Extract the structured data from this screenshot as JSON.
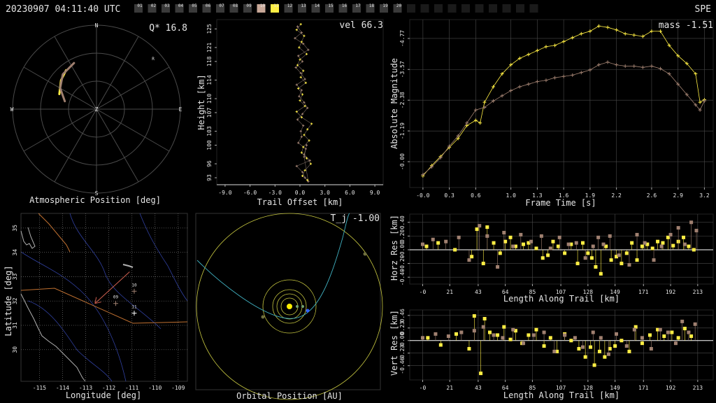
{
  "header": {
    "timestamp": "20230907 04:11:40 UTC",
    "network": "SPE",
    "station_labels": [
      "01",
      "02",
      "03",
      "04",
      "05",
      "06",
      "07",
      "08",
      "09",
      "10",
      "11",
      "12",
      "13",
      "14",
      "15",
      "16",
      "17",
      "18",
      "19",
      "20"
    ],
    "station_states": [
      1,
      1,
      1,
      1,
      1,
      1,
      1,
      1,
      1,
      2,
      3,
      1,
      1,
      1,
      1,
      1,
      1,
      1,
      1,
      1
    ],
    "state_colors": [
      "#1a1a1a",
      "#3a3a3a",
      "#c8a898",
      "#ffee44"
    ]
  },
  "colors": {
    "station_a": "#ffee44",
    "station_b": "#a08070",
    "orbit": "#c8c840",
    "trajectory": "#40b0c0",
    "grid": "#4a4a4a",
    "border_state": "#c07030",
    "rivers": "#3040a0",
    "coast": "#b0b0b0"
  },
  "labels": {
    "polar_title": "Atmospheric Position [deg]",
    "polar_q": "Q* 16.8",
    "dirs": {
      "n": "N",
      "e": "E",
      "s": "S",
      "w": "W",
      "z": "Z",
      "r": "R"
    },
    "height_ylabel": "Height [km]",
    "height_xlabel": "Trail Offset [km]",
    "height_vel": "vel 66.3",
    "mag_ylabel": "Absolute Magnitude",
    "mag_xlabel": "Frame Time [s]",
    "mag_mass": "mass -1.51",
    "map_ylabel": "Latitude [deg]",
    "map_xlabel": "Longitude [deg]",
    "orbit_xlabel": "Orbital Position [AU]",
    "orbit_tj": "T_j -1.00",
    "horz_ylabel": "Horz Res [km]",
    "vert_ylabel": "Vert Res [km]",
    "res_xlabel": "Length Along Trail [km]"
  },
  "chart_data": [
    {
      "id": "polar",
      "type": "line",
      "title": "Atmospheric Position [deg]",
      "series": [
        {
          "color": "#ffee44",
          "points": [
            [
              -68,
              47
            ],
            [
              -51,
              41
            ],
            [
              -38,
              37
            ]
          ]
        },
        {
          "color": "#a08070",
          "points": [
            [
              -76,
              55
            ],
            [
              -60,
              45
            ],
            [
              -44,
              38
            ],
            [
              -26,
              35
            ]
          ]
        }
      ]
    },
    {
      "id": "height",
      "type": "scatter",
      "xlabel": "Trail Offset [km]",
      "ylabel": "Height [km]",
      "xlim": [
        -10,
        10
      ],
      "ylim": [
        91.5,
        127
      ],
      "x_ticks": [
        "-9.0",
        "-6.0",
        "-3.0",
        "0.0",
        "3.0",
        "6.0",
        "9.0"
      ],
      "x_tick_values": [
        -9,
        -6,
        -3,
        0,
        3,
        6,
        9
      ],
      "y_ticks": [
        "93",
        "96",
        "100",
        "103",
        "107",
        "110",
        "114",
        "118",
        "121",
        "125"
      ],
      "y_tick_values": [
        93,
        96,
        100,
        103,
        107,
        110,
        114,
        118,
        121,
        125
      ],
      "series": [
        {
          "name": "10",
          "x": [
            -0.3,
            0.2,
            -0.6,
            0.4,
            1.0,
            -0.2,
            0.3,
            -0.5,
            0.1,
            0.6,
            -0.4,
            0.2,
            -0.1,
            0.5,
            0.9,
            0.3,
            -0.3,
            0.4,
            0.1,
            0.2,
            -0.2,
            0.7,
            0.5,
            1.2,
            -0.4,
            0.3,
            0.6,
            1.0,
            0.5,
            0.8
          ],
          "y": [
            125.5,
            124.2,
            123.0,
            121.8,
            120.5,
            119.2,
            118.0,
            116.7,
            115.5,
            114.2,
            113.0,
            111.8,
            110.5,
            109.2,
            108.0,
            106.7,
            105.5,
            104.2,
            103.0,
            101.8,
            100.5,
            99.2,
            98.0,
            96.7,
            95.5,
            94.2,
            93.0,
            92.2,
            97.5,
            100.0
          ]
        },
        {
          "name": "11",
          "x": [
            0.1,
            -0.4,
            0.5,
            0.2,
            -0.1,
            0.8,
            0.0,
            -0.3,
            0.4,
            0.1,
            0.7,
            -0.2,
            0.3,
            0.0,
            0.6,
            -0.4,
            0.2,
            1.4,
            0.9,
            0.5,
            1.1,
            0.4,
            0.2,
            0.8,
            1.3,
            0.6,
            0.3,
            0.9
          ],
          "y": [
            126.0,
            124.8,
            123.5,
            122.2,
            121.0,
            119.6,
            118.4,
            117.2,
            116.0,
            114.6,
            113.4,
            112.2,
            110.9,
            109.6,
            108.4,
            107.2,
            106.0,
            104.6,
            103.4,
            102.2,
            101.0,
            99.6,
            98.4,
            97.2,
            96.0,
            94.6,
            93.4,
            92.5
          ]
        }
      ]
    },
    {
      "id": "magnitude",
      "type": "line",
      "xlabel": "Frame Time [s]",
      "ylabel": "Absolute Magnitude",
      "xlim": [
        -0.15,
        3.3
      ],
      "ylim": [
        1.0,
        -5.5
      ],
      "x_ticks": [
        "-0.0",
        "0.3",
        "0.6",
        "1.0",
        "1.3",
        "1.6",
        "1.9",
        "2.2",
        "2.6",
        "2.9",
        "3.2"
      ],
      "x_tick_values": [
        0,
        0.3,
        0.6,
        1.0,
        1.3,
        1.6,
        1.9,
        2.2,
        2.6,
        2.9,
        3.2
      ],
      "y_ticks": [
        "-4.77",
        "-3.57",
        "-2.38",
        "-1.19",
        "-0.00"
      ],
      "y_tick_values": [
        -4.77,
        -3.57,
        -2.38,
        -1.19,
        0.0
      ],
      "series": [
        {
          "name": "11",
          "color": "#ffee44",
          "x": [
            0.0,
            0.1,
            0.2,
            0.3,
            0.4,
            0.5,
            0.6,
            0.65,
            0.7,
            0.8,
            0.9,
            1.0,
            1.1,
            1.2,
            1.3,
            1.4,
            1.5,
            1.6,
            1.7,
            1.8,
            1.9,
            2.0,
            2.1,
            2.2,
            2.3,
            2.4,
            2.5,
            2.6,
            2.7,
            2.8,
            2.9,
            3.0,
            3.1,
            3.15,
            3.2
          ],
          "y": [
            0.55,
            0.15,
            -0.2,
            -0.55,
            -0.9,
            -1.4,
            -1.6,
            -1.5,
            -2.3,
            -2.9,
            -3.4,
            -3.75,
            -4.0,
            -4.15,
            -4.3,
            -4.45,
            -4.5,
            -4.65,
            -4.8,
            -4.95,
            -5.05,
            -5.25,
            -5.2,
            -5.1,
            -4.95,
            -4.9,
            -4.85,
            -5.05,
            -5.05,
            -4.5,
            -4.1,
            -3.8,
            -3.4,
            -2.3,
            -2.4
          ]
        },
        {
          "name": "10",
          "color": "#a08070",
          "x": [
            0.0,
            0.1,
            0.2,
            0.3,
            0.4,
            0.5,
            0.6,
            0.7,
            0.8,
            0.9,
            1.0,
            1.1,
            1.2,
            1.3,
            1.4,
            1.5,
            1.6,
            1.7,
            1.8,
            1.9,
            2.0,
            2.1,
            2.2,
            2.3,
            2.4,
            2.5,
            2.6,
            2.7,
            2.8,
            2.9,
            3.0,
            3.1,
            3.15,
            3.2
          ],
          "y": [
            0.5,
            0.2,
            -0.15,
            -0.6,
            -1.0,
            -1.5,
            -2.0,
            -2.1,
            -2.35,
            -2.55,
            -2.75,
            -2.9,
            -3.0,
            -3.1,
            -3.15,
            -3.25,
            -3.3,
            -3.35,
            -3.45,
            -3.55,
            -3.75,
            -3.85,
            -3.75,
            -3.7,
            -3.7,
            -3.65,
            -3.7,
            -3.6,
            -3.4,
            -3.0,
            -2.6,
            -2.2,
            -2.0,
            -2.35
          ]
        }
      ]
    },
    {
      "id": "map",
      "type": "scatter",
      "xlabel": "Longitude [deg]",
      "ylabel": "Latitude [deg]",
      "xlim": [
        -115.8,
        -108.6
      ],
      "ylim": [
        28.7,
        35.6
      ],
      "x_ticks": [
        "-115",
        "-114",
        "-113",
        "-112",
        "-111",
        "-110",
        "-109"
      ],
      "x_tick_values": [
        -115,
        -114,
        -113,
        -112,
        -111,
        -110,
        -109
      ],
      "y_ticks": [
        "30",
        "31",
        "32",
        "33",
        "34",
        "35"
      ],
      "y_tick_values": [
        30,
        31,
        32,
        33,
        34,
        35
      ],
      "stations": [
        {
          "label": "10",
          "lon": -110.9,
          "lat": 32.4,
          "color": "#a08070"
        },
        {
          "label": "09",
          "lon": -111.7,
          "lat": 31.9,
          "color": "#a08070"
        },
        {
          "label": "11",
          "lon": -110.9,
          "lat": 31.5,
          "color": "#ffffff"
        }
      ],
      "trail": [
        [
          -111.1,
          33.2
        ],
        [
          -112.6,
          31.9
        ]
      ]
    },
    {
      "id": "orbit",
      "type": "scatter",
      "title": "Orbital Position [AU]",
      "annotation": "T_j -1.00"
    },
    {
      "id": "horz_res",
      "type": "scatter",
      "xlabel": "Length Along Trail [km]",
      "ylabel": "Horz Res [km]",
      "xlim": [
        -10,
        225
      ],
      "ylim": [
        -0.5,
        0.52
      ],
      "x_ticks": [
        "-0",
        "21",
        "43",
        "64",
        "85",
        "107",
        "128",
        "149",
        "171",
        "192",
        "213"
      ],
      "x_tick_values": [
        0,
        21,
        43,
        64,
        85,
        107,
        128,
        149,
        171,
        192,
        213
      ],
      "y_ticks": [
        "0.40",
        "0.20",
        "-0.00",
        "-0.20",
        "-0.40"
      ],
      "y_tick_values": [
        0.4,
        0.2,
        0,
        -0.2,
        -0.4
      ],
      "series": [
        {
          "name": "11",
          "color": "#ffee44",
          "x": [
            3,
            12,
            25,
            38,
            42,
            47,
            50,
            55,
            60,
            64,
            68,
            72,
            78,
            82,
            88,
            93,
            97,
            101,
            105,
            110,
            115,
            120,
            124,
            128,
            131,
            134,
            138,
            142,
            146,
            150,
            154,
            158,
            162,
            166,
            170,
            174,
            178,
            182,
            186,
            190,
            194,
            198,
            202,
            206,
            210
          ],
          "y": [
            0.05,
            0.1,
            0.0,
            -0.1,
            0.3,
            -0.2,
            0.33,
            0.1,
            -0.05,
            0.12,
            0.18,
            0.05,
            0.08,
            0.1,
            0.02,
            -0.12,
            -0.08,
            0.12,
            0.05,
            -0.05,
            0.08,
            -0.2,
            0.1,
            -0.05,
            -0.12,
            -0.25,
            -0.35,
            0.05,
            -0.15,
            -0.1,
            -0.2,
            -0.05,
            0.1,
            -0.15,
            0.05,
            0.08,
            0.02,
            0.12,
            0.1,
            0.18,
            0.06,
            0.12,
            0.18,
            0.05,
            0.0
          ]
        },
        {
          "name": "10",
          "color": "#a08070",
          "x": [
            0,
            8,
            18,
            28,
            36,
            44,
            50,
            58,
            63,
            70,
            76,
            84,
            92,
            99,
            106,
            113,
            119,
            126,
            132,
            136,
            140,
            145,
            152,
            160,
            166,
            172,
            179,
            185,
            192,
            198,
            203,
            208,
            212
          ],
          "y": [
            0.08,
            0.15,
            0.12,
            0.18,
            -0.15,
            0.35,
            0.2,
            -0.25,
            0.25,
            0.05,
            0.22,
            0.12,
            0.2,
            0.02,
            0.18,
            0.08,
            0.1,
            -0.12,
            0.05,
            0.18,
            0.08,
            0.2,
            -0.08,
            -0.22,
            0.22,
            0.1,
            -0.15,
            0.05,
            0.22,
            0.32,
            0.08,
            0.4,
            0.28
          ]
        }
      ]
    },
    {
      "id": "vert_res",
      "type": "scatter",
      "xlabel": "Length Along Trail [km]",
      "ylabel": "Vert Res [km]",
      "xlim": [
        -10,
        225
      ],
      "ylim": [
        -0.72,
        0.56
      ],
      "x_ticks": [
        "-0",
        "21",
        "43",
        "64",
        "85",
        "107",
        "128",
        "149",
        "171",
        "192",
        "213"
      ],
      "x_tick_values": [
        0,
        21,
        43,
        64,
        85,
        107,
        128,
        149,
        171,
        192,
        213
      ],
      "y_ticks": [
        "0.46",
        "0.23",
        "-0.00",
        "-0.23",
        "-0.46"
      ],
      "y_tick_values": [
        0.46,
        0.23,
        0,
        -0.23,
        -0.46
      ],
      "series": [
        {
          "name": "11",
          "color": "#ffee44",
          "x": [
            4,
            14,
            26,
            36,
            40,
            45,
            48,
            52,
            58,
            63,
            68,
            72,
            77,
            82,
            88,
            94,
            99,
            104,
            110,
            115,
            121,
            126,
            130,
            133,
            137,
            141,
            145,
            149,
            154,
            160,
            165,
            170,
            176,
            182,
            187,
            193,
            198,
            203,
            208
          ],
          "y": [
            0.05,
            -0.08,
            0.12,
            -0.15,
            0.45,
            -0.6,
            0.4,
            0.15,
            0.1,
            0.25,
            0.02,
            0.18,
            -0.05,
            0.1,
            0.2,
            -0.1,
            0.05,
            -0.2,
            0.12,
            0.0,
            -0.15,
            -0.3,
            -0.12,
            -0.45,
            -0.2,
            -0.3,
            -0.15,
            -0.1,
            0.0,
            -0.2,
            0.25,
            -0.05,
            0.1,
            0.2,
            0.08,
            0.15,
            0.05,
            0.22,
            0.08
          ]
        },
        {
          "name": "10",
          "color": "#a08070",
          "x": [
            0,
            10,
            20,
            30,
            40,
            47,
            55,
            62,
            70,
            78,
            86,
            94,
            102,
            110,
            118,
            124,
            132,
            138,
            144,
            150,
            158,
            164,
            170,
            177,
            184,
            190,
            196,
            201,
            206,
            211
          ],
          "y": [
            0.05,
            0.12,
            0.08,
            0.15,
            0.18,
            0.25,
            0.1,
            0.05,
            0.2,
            -0.05,
            0.1,
            0.15,
            -0.2,
            0.1,
            0.05,
            -0.12,
            0.15,
            0.05,
            -0.25,
            0.12,
            -0.1,
            0.2,
            0.05,
            -0.15,
            0.2,
            0.15,
            -0.05,
            0.35,
            0.15,
            0.3
          ]
        }
      ]
    }
  ]
}
